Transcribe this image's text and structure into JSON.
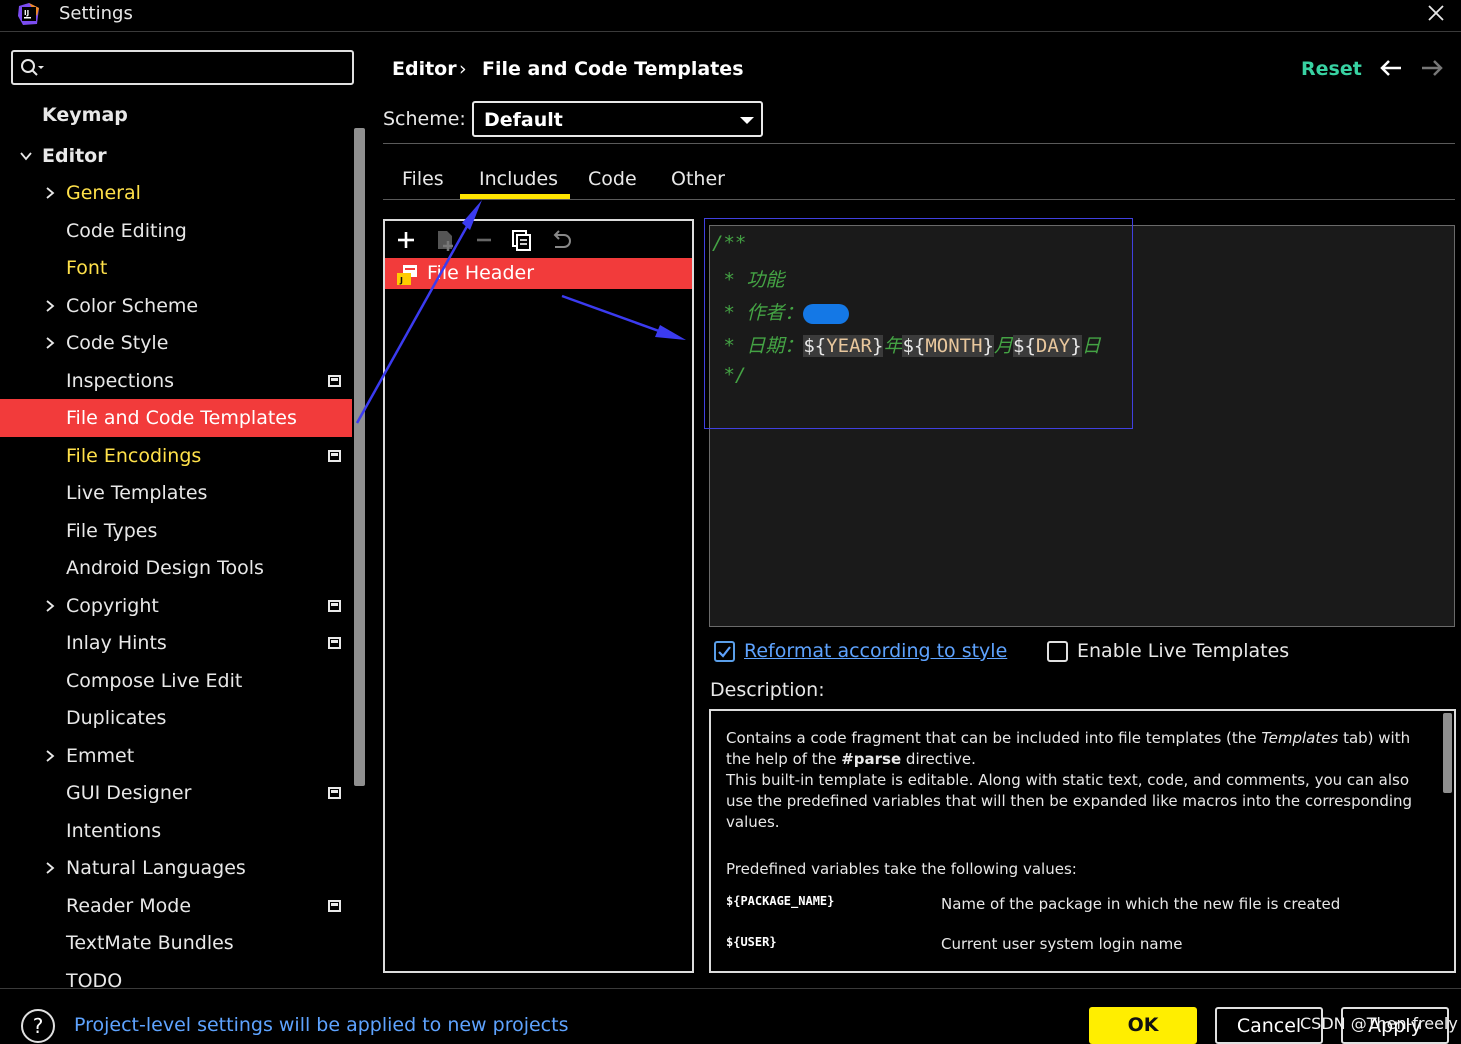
{
  "window": {
    "title": "Settings"
  },
  "search": {
    "placeholder": "",
    "value": ""
  },
  "sidebar": {
    "items": [
      {
        "label": "Keymap"
      },
      {
        "label": "Editor"
      },
      {
        "label": "General"
      },
      {
        "label": "Code Editing"
      },
      {
        "label": "Font"
      },
      {
        "label": "Color Scheme"
      },
      {
        "label": "Code Style"
      },
      {
        "label": "Inspections"
      },
      {
        "label": "File and Code Templates"
      },
      {
        "label": "File Encodings"
      },
      {
        "label": "Live Templates"
      },
      {
        "label": "File Types"
      },
      {
        "label": "Android Design Tools"
      },
      {
        "label": "Copyright"
      },
      {
        "label": "Inlay Hints"
      },
      {
        "label": "Compose Live Edit"
      },
      {
        "label": "Duplicates"
      },
      {
        "label": "Emmet"
      },
      {
        "label": "GUI Designer"
      },
      {
        "label": "Intentions"
      },
      {
        "label": "Natural Languages"
      },
      {
        "label": "Reader Mode"
      },
      {
        "label": "TextMate Bundles"
      },
      {
        "label": "TODO"
      }
    ]
  },
  "header": {
    "breadcrumb_parent": "Editor",
    "breadcrumb_sep": "›",
    "breadcrumb_current": "File and Code Templates",
    "reset_label": "Reset"
  },
  "scheme": {
    "label": "Scheme:",
    "value": "Default"
  },
  "tabs": [
    {
      "label": "Files"
    },
    {
      "label": "Includes"
    },
    {
      "label": "Code"
    },
    {
      "label": "Other"
    }
  ],
  "templates": {
    "items": [
      {
        "label": "File Header"
      }
    ]
  },
  "editor": {
    "line1": "/**",
    "line2": " * 功能",
    "line3": " * 作者：",
    "line4_prefix": " * 日期：",
    "var_year": "YEAR",
    "sep_year": "年",
    "var_month": "MONTH",
    "sep_month": "月",
    "var_day": "DAY",
    "sep_day": "日",
    "line5": " */"
  },
  "options": {
    "reformat_label": "Reformat according to style",
    "reformat_checked": true,
    "live_templates_label": "Enable Live Templates",
    "live_templates_checked": false
  },
  "description": {
    "label": "Description:",
    "p1_a": "Contains a code fragment that can be included into file templates (the",
    "p1_em": "Templates",
    "p1_b": "tab) with",
    "p1_c": "the help of the",
    "p1_strong": "#parse",
    "p1_d": "directive.",
    "p2": "This built-in template is editable. Along with static text, code, and comments, you can also use the predefined variables that will then be expanded like macros into the corresponding values.",
    "p3": "Predefined variables take the following values:",
    "vars": [
      {
        "name": "${PACKAGE_NAME}",
        "desc": "Name of the package in which the new file is created"
      },
      {
        "name": "${USER}",
        "desc": "Current user system login name"
      }
    ]
  },
  "footer": {
    "help_label": "?",
    "info_text": "Project-level settings will be applied to new projects",
    "ok_label": "OK",
    "cancel_label": "Cancel",
    "apply_label": "Apply",
    "watermark": "CSDN @Then-freely"
  },
  "colors": {
    "selection": "#f23b3b",
    "highlight_text": "#ffe14a",
    "accent_green": "#38d2a2",
    "link_blue": "#5ea3ff",
    "ok_yellow": "#ffee00"
  }
}
